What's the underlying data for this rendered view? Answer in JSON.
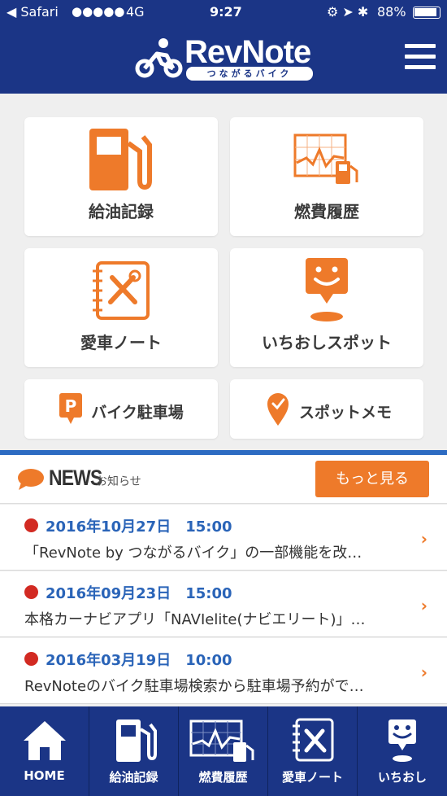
{
  "status": {
    "carrier": "Safari",
    "signal": "●●●●●",
    "network": "4G",
    "time": "9:27",
    "battery": "88%"
  },
  "header": {
    "logo_text": "RevNote",
    "logo_sub": "つながるバイク"
  },
  "tiles": {
    "refuel": "給油記録",
    "fuel_history": "燃費履歴",
    "bike_note": "愛車ノート",
    "spot": "いちおしスポット",
    "parking": "バイク駐車場",
    "spot_memo": "スポットメモ"
  },
  "news": {
    "title": "NEWS",
    "subtitle": "お知らせ",
    "more_label": "もっと見る",
    "items": [
      {
        "date": "2016年10月27日　15:00",
        "text": "「RevNote by つながるバイク」の一部機能を改…"
      },
      {
        "date": "2016年09月23日　15:00",
        "text": "本格カーナビアプリ「NAVIelite(ナビエリート)」…"
      },
      {
        "date": "2016年03月19日　10:00",
        "text": "RevNoteのバイク駐車場検索から駐車場予約がで…"
      }
    ]
  },
  "tabbar": {
    "home": "HOME",
    "refuel": "給油記録",
    "fuel_history": "燃費履歴",
    "bike_note": "愛車ノート",
    "spot": "いちおし"
  },
  "colors": {
    "navy": "#1b3586",
    "orange": "#ee7a2a",
    "blue": "#2c6bc2",
    "red": "#d22a22"
  }
}
